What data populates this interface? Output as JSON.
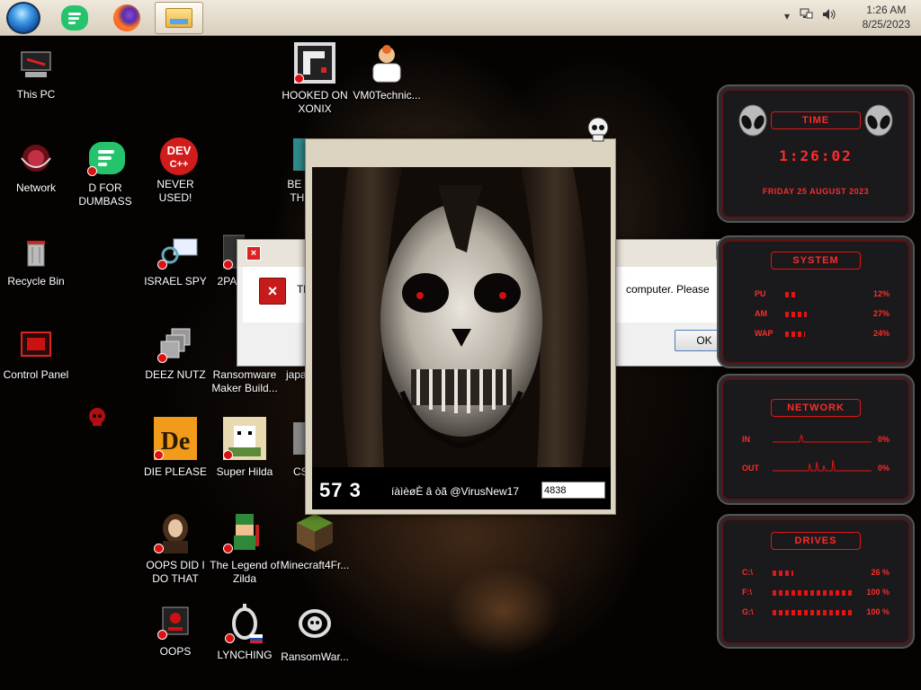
{
  "taskbar": {
    "clock_time": "1:26 AM",
    "clock_date": "8/25/2023",
    "tray_icons": [
      "chevron-up-icon",
      "network-icon",
      "volume-icon"
    ]
  },
  "desktop_icons": [
    {
      "label": "This PC",
      "icon": "computer-icon"
    },
    {
      "label": "Network",
      "icon": "network-icon"
    },
    {
      "label": "Recycle Bin",
      "icon": "recycle-bin-icon"
    },
    {
      "label": "Control Panel",
      "icon": "control-panel-icon"
    },
    {
      "label": "D FOR DUMBASS",
      "icon": "app-icon"
    },
    {
      "label": "NEVER USED!",
      "icon": "dev-cpp-icon"
    },
    {
      "label": "ISRAEL SPY",
      "icon": "spy-icon"
    },
    {
      "label": "DEEZ NUTZ",
      "icon": "windows-stack-icon"
    },
    {
      "label": "DIE PLEASE",
      "icon": "die-icon"
    },
    {
      "label": "OOPS DID I DO THAT",
      "icon": "portrait-icon"
    },
    {
      "label": "OOPS",
      "icon": "oops-icon"
    },
    {
      "label": "HOOKED ON XONIX",
      "icon": "xonix-icon"
    },
    {
      "label": "VM0Technic...",
      "icon": "doctor-icon"
    },
    {
      "label": "BE J THI",
      "icon": "app-icon"
    },
    {
      "label": "2PAC",
      "icon": "app-icon"
    },
    {
      "label": "Ransomware Maker Build...",
      "icon": "ransomware-icon"
    },
    {
      "label": "japa",
      "icon": "app-icon"
    },
    {
      "label": "Super Hilda",
      "icon": "pixel-icon"
    },
    {
      "label": "CS",
      "icon": "app-icon"
    },
    {
      "label": "The Legend of Zilda",
      "icon": "zelda-icon"
    },
    {
      "label": "Minecraft4Fr...",
      "icon": "minecraft-icon"
    },
    {
      "label": "LYNCHING",
      "icon": "noose-icon"
    },
    {
      "label": "RansomWar...",
      "icon": "skull-icon"
    }
  ],
  "error_dialog": {
    "message_left": "Th co",
    "message_right": "computer. Please",
    "ok_label": "OK",
    "close_label": "✕"
  },
  "skull_window": {
    "countdown": "57 3",
    "contact": "íàìèøÈ â òã @VirusNew17",
    "key_value": "4838"
  },
  "gadgets": {
    "time": {
      "title": "TIME",
      "clock": "1:26:02",
      "date": "FRIDAY 25 AUGUST 2023"
    },
    "system": {
      "title": "SYSTEM",
      "rows": [
        {
          "label": "PU",
          "value": "12%",
          "level": 0.12
        },
        {
          "label": "AM",
          "value": "27%",
          "level": 0.27
        },
        {
          "label": "WAP",
          "value": "24%",
          "level": 0.24
        }
      ]
    },
    "network": {
      "title": "NETWORK",
      "rows": [
        {
          "label": "IN",
          "value": "0%"
        },
        {
          "label": "OUT",
          "value": "0%"
        }
      ]
    },
    "drives": {
      "title": "DRIVES",
      "rows": [
        {
          "label": "C:\\",
          "value": "26 %",
          "level": 0.26
        },
        {
          "label": "F:\\",
          "value": "100 %",
          "level": 1.0
        },
        {
          "label": "G:\\",
          "value": "100 %",
          "level": 1.0
        }
      ]
    }
  }
}
